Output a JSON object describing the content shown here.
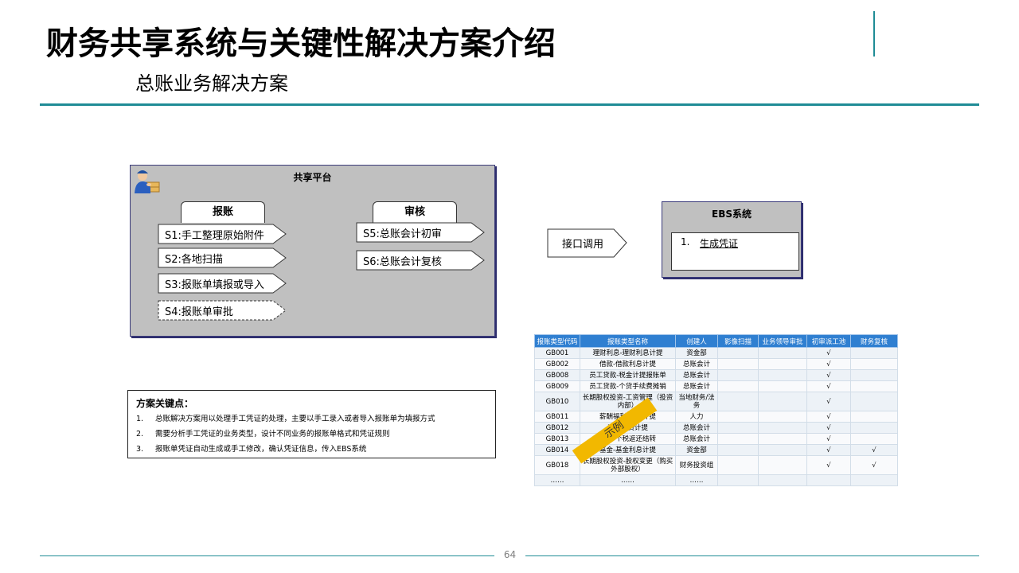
{
  "header": {
    "title": "财务共享系统与关键性解决方案介绍",
    "subtitle": "总账业务解决方案"
  },
  "platform": {
    "title": "共享平台",
    "tab_left": "报账",
    "tab_right": "审核",
    "steps_left": [
      "S1:手工整理原始附件",
      "S2:各地扫描",
      "S3:报账单填报或导入",
      "S4:报账单审批"
    ],
    "steps_right": [
      "S5:总账会计初审",
      "S6:总账会计复核"
    ]
  },
  "interface": {
    "label": "接口调用"
  },
  "ebs": {
    "title": "EBS系统",
    "item_number": "1.",
    "item_text": "生成凭证"
  },
  "key_points": {
    "title": "方案关键点：",
    "items": [
      {
        "n": "1.",
        "text": "总账解决方案用以处理手工凭证的处理，主要以手工录入或者导入报账单为填报方式"
      },
      {
        "n": "2.",
        "text": "需要分析手工凭证的业务类型，设计不同业务的报账单格式和凭证规则"
      },
      {
        "n": "3.",
        "text": "报账单凭证自动生成或手工修改，确认凭证信息，传入EBS系统"
      }
    ]
  },
  "table": {
    "headers": [
      "报账类型代码",
      "报账类型名称",
      "创建人",
      "影像扫描",
      "业务领导审批",
      "初审派工池",
      "财务复核"
    ],
    "rows": [
      [
        "GB001",
        "理财利息-理财利息计提",
        "资金部",
        "",
        "",
        "√",
        ""
      ],
      [
        "GB002",
        "借款-借款利息计提",
        "总账会计",
        "",
        "",
        "√",
        ""
      ],
      [
        "GB008",
        "员工贷款-税金计提报账单",
        "总账会计",
        "",
        "",
        "√",
        ""
      ],
      [
        "GB009",
        "员工贷款-个贷手续费摊销",
        "总账会计",
        "",
        "",
        "√",
        ""
      ],
      [
        "GB010",
        "长期股权投资-工资管理（投资内部）",
        "当地财务/法务",
        "",
        "",
        "√",
        ""
      ],
      [
        "GB011",
        "薪酬福利-资金计提",
        "人力",
        "",
        "",
        "√",
        ""
      ],
      [
        "GB012",
        "工会经费计提",
        "总账会计",
        "",
        "",
        "√",
        ""
      ],
      [
        "GB013",
        "福利-个税返还结转",
        "总账会计",
        "",
        "",
        "√",
        ""
      ],
      [
        "GB014",
        "基金-基金利息计提",
        "资金部",
        "",
        "",
        "√",
        "√"
      ],
      [
        "GB018",
        "长期股权投资-股权变更（购买外部股权）",
        "财务投资组",
        "",
        "",
        "√",
        "√"
      ],
      [
        "……",
        "……",
        "……",
        "",
        "",
        "",
        ""
      ]
    ]
  },
  "stamp": "示例",
  "footer": {
    "page_number": "64"
  },
  "colors": {
    "accent": "#1f8c96",
    "table_header": "#2f7fd1",
    "stamp": "#f2b800",
    "panel": "#c0c0c0"
  }
}
